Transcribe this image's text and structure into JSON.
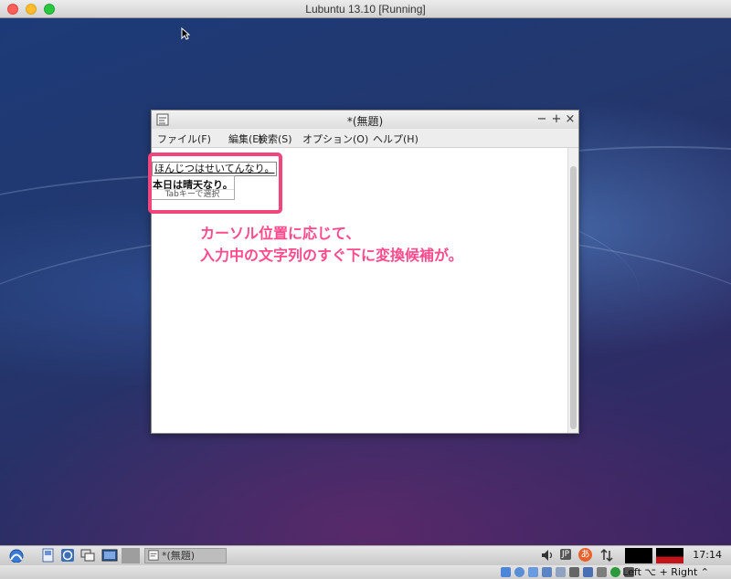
{
  "host_window": {
    "title": "Lubuntu 13.10 [Running]"
  },
  "app_window": {
    "title": "*(無題)",
    "minimize_symbol": "−",
    "maximize_symbol": "+",
    "close_symbol": "×",
    "menu": [
      "ファイル(F)",
      "編集(E)",
      "検索(S)",
      "オプション(O)",
      "ヘルプ(H)"
    ]
  },
  "ime": {
    "preedit_text": "ほんじつはせいてんなり。",
    "candidate": "本日は晴天なり。",
    "hint": "Tabキーで選択"
  },
  "annotation": {
    "line1": "カーソル位置に応じて、",
    "line2": "入力中の文字列のすぐ下に変換候補が。"
  },
  "taskbar": {
    "task_label": "*(無題)",
    "input_indicator": "JP",
    "ime_mode": "あ",
    "clock": "17:14"
  },
  "vbox_status": {
    "host_key": "Left ⌥ + Right ⌃"
  },
  "colors": {
    "annotation": "#ff4a8d",
    "highlight_border": "#f2457e"
  }
}
